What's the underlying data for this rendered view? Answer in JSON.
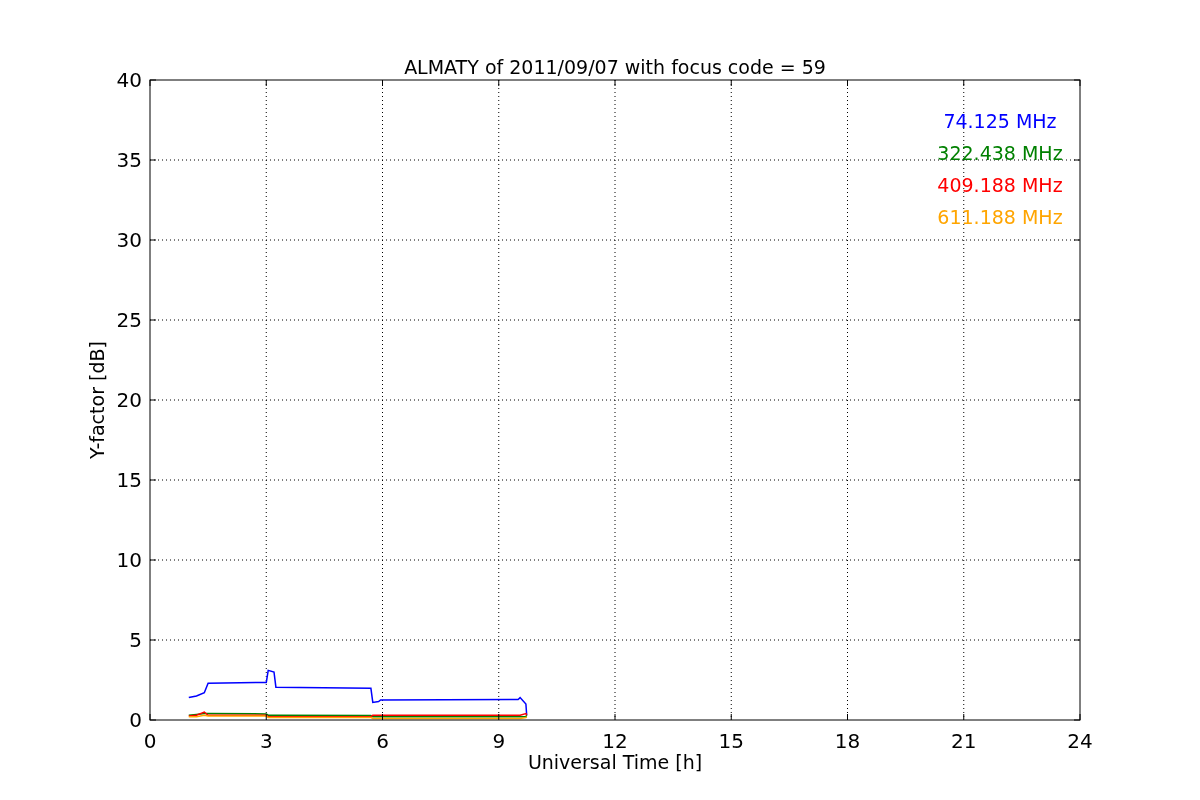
{
  "chart_data": {
    "type": "line",
    "title": "ALMATY of 2011/09/07 with focus code = 59",
    "xlabel": "Universal Time [h]",
    "ylabel": "Y-factor [dB]",
    "x": [
      1.0,
      1.2,
      1.4,
      1.5,
      3.0,
      3.05,
      3.2,
      3.25,
      5.7,
      5.75,
      5.9,
      5.95,
      9.5,
      9.55,
      9.7,
      9.72
    ],
    "series": [
      {
        "name": "74.125 MHz",
        "color": "#0000ff",
        "values": [
          1.4,
          1.5,
          1.7,
          2.3,
          2.35,
          3.1,
          3.0,
          2.05,
          1.98,
          1.1,
          1.15,
          1.25,
          1.28,
          1.4,
          1.0,
          0.3
        ]
      },
      {
        "name": "322.438 MHz",
        "color": "#008000",
        "values": [
          0.3,
          0.35,
          0.4,
          0.4,
          0.38,
          0.3,
          0.3,
          0.3,
          0.28,
          0.2,
          0.2,
          0.2,
          0.2,
          0.2,
          0.2,
          0.3
        ]
      },
      {
        "name": "409.188 MHz",
        "color": "#ff0000",
        "values": [
          0.25,
          0.3,
          0.5,
          0.3,
          0.3,
          0.2,
          0.2,
          0.2,
          0.2,
          0.3,
          0.3,
          0.3,
          0.3,
          0.3,
          0.4,
          0.3
        ]
      },
      {
        "name": "611.188 MHz",
        "color": "#ffa500",
        "values": [
          0.2,
          0.2,
          0.3,
          0.25,
          0.25,
          0.15,
          0.15,
          0.15,
          0.15,
          0.1,
          0.1,
          0.1,
          0.1,
          0.1,
          0.15,
          0.2
        ]
      }
    ],
    "xlim": [
      0,
      24
    ],
    "ylim": [
      0,
      40
    ],
    "xticks": [
      0,
      3,
      6,
      9,
      12,
      15,
      18,
      21,
      24
    ],
    "yticks": [
      0,
      5,
      10,
      15,
      20,
      25,
      30,
      35,
      40
    ],
    "grid": true
  }
}
